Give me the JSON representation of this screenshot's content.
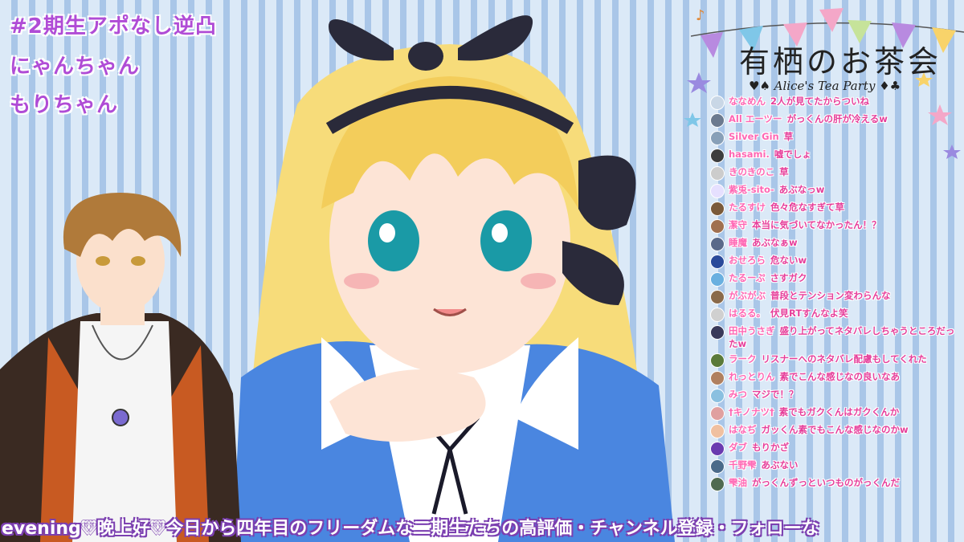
{
  "overlay": {
    "line1": "#2期生アポなし逆凸",
    "line2": "にゃんちゃん",
    "line3": "もりちゃん"
  },
  "logo": {
    "title": "有栖のお茶会",
    "subtitle": "♥♠ Alice's Tea Party ♦♣"
  },
  "chat": {
    "messages": [
      {
        "name": "ななめん",
        "text": "2人が見てたからついね",
        "avatar_color": "#c9d7e6"
      },
      {
        "name": "All エーツー",
        "text": "がっくんの肝が冷えるw",
        "avatar_color": "#6b7a8f"
      },
      {
        "name": "Silver Gin",
        "text": "草",
        "avatar_color": "#88a0b8"
      },
      {
        "name": "hasami.",
        "text": "嘘でしょ",
        "avatar_color": "#3d3d3d"
      },
      {
        "name": "きのきのこ",
        "text": "草",
        "avatar_color": "#cccccc"
      },
      {
        "name": "紫兎-sito-",
        "text": "あぶなっw",
        "avatar_color": "#e6e0ff"
      },
      {
        "name": "たるすけ",
        "text": "色々危なすぎて草",
        "avatar_color": "#7a5a3a"
      },
      {
        "name": "潔守",
        "text": "本当に気づいてなかったん！？",
        "avatar_color": "#a07050"
      },
      {
        "name": "睡魔",
        "text": "あぶなぁw",
        "avatar_color": "#5a6a8a"
      },
      {
        "name": "おせろら",
        "text": "危ないw",
        "avatar_color": "#2a4a9a"
      },
      {
        "name": "たるーぷ",
        "text": "さすガク",
        "avatar_color": "#6ab0e0"
      },
      {
        "name": "がぶがぶ",
        "text": "普段とテンション変わらんな",
        "avatar_color": "#8a6a4a"
      },
      {
        "name": "はるる。",
        "text": "伏見RTすんなよ笑",
        "avatar_color": "#d0d0d0"
      },
      {
        "name": "田中うさぎ",
        "text": "盛り上がってネタバレしちゃうところだったw",
        "avatar_color": "#3a3a5a"
      },
      {
        "name": "ラーク",
        "text": "リスナーへのネタバレ配慮もしてくれた",
        "avatar_color": "#5a7a3a"
      },
      {
        "name": "れっとりん",
        "text": "素でこんな感じなの良いなあ",
        "avatar_color": "#b08060"
      },
      {
        "name": "みつ",
        "text": "マジで！？",
        "avatar_color": "#8ac0e0"
      },
      {
        "name": "†キノナツ†",
        "text": "素でもガクくんはガクくんか",
        "avatar_color": "#e0a0a0"
      },
      {
        "name": "はなぢ",
        "text": "ガッくん素でもこんな感じなのかw",
        "avatar_color": "#f0c0a0"
      },
      {
        "name": "ダブ",
        "text": "もりかざ",
        "avatar_color": "#6a3ab0"
      },
      {
        "name": "千野雫",
        "text": "あぶない",
        "avatar_color": "#4a6a8a"
      },
      {
        "name": "雫油",
        "text": "がっくんずっといつものがっくんだ",
        "avatar_color": "#506a50"
      }
    ]
  },
  "ticker": {
    "text": "evening♡晚上好♡今日から四年目のフリーダムな二期生たちの高評価・チャンネル登録・フォローな"
  },
  "colors": {
    "title_purple": "#b04cd6",
    "chat_pink": "#e63e9a",
    "stripe_light": "#dbe9f7",
    "stripe_dark": "#a9c6e8"
  }
}
